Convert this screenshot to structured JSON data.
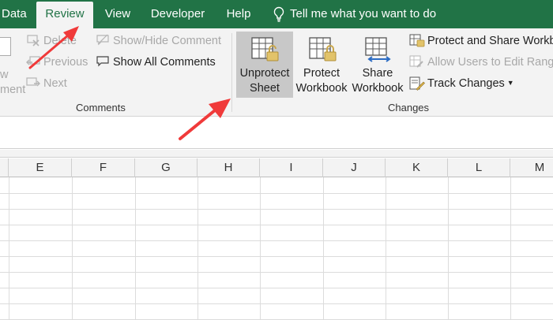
{
  "tabs": [
    {
      "label": "Data",
      "active": false
    },
    {
      "label": "Review",
      "active": true
    },
    {
      "label": "View",
      "active": false
    },
    {
      "label": "Developer",
      "active": false
    },
    {
      "label": "Help",
      "active": false
    }
  ],
  "tell_me": "Tell me what you want to do",
  "ribbon": {
    "left_partial": {
      "line1": "w",
      "line2": "ment"
    },
    "comments": {
      "delete": "Delete",
      "previous": "Previous",
      "next": "Next",
      "show_hide": "Show/Hide Comment",
      "show_all": "Show All Comments",
      "group_label": "Comments"
    },
    "changes": {
      "unprotect_sheet": {
        "line1": "Unprotect",
        "line2": "Sheet"
      },
      "protect_workbook": {
        "line1": "Protect",
        "line2": "Workbook"
      },
      "share_workbook": {
        "line1": "Share",
        "line2": "Workbook"
      },
      "protect_share": "Protect and Share Workbook",
      "allow_users": "Allow Users to Edit Ranges",
      "track_changes": "Track Changes",
      "group_label": "Changes"
    }
  },
  "columns": [
    "E",
    "F",
    "G",
    "H",
    "I",
    "J",
    "K",
    "L",
    "M"
  ],
  "colors": {
    "accent": "#217346",
    "annotation_arrow": "#f03a3a",
    "selected_button": "#c8c8c8"
  }
}
